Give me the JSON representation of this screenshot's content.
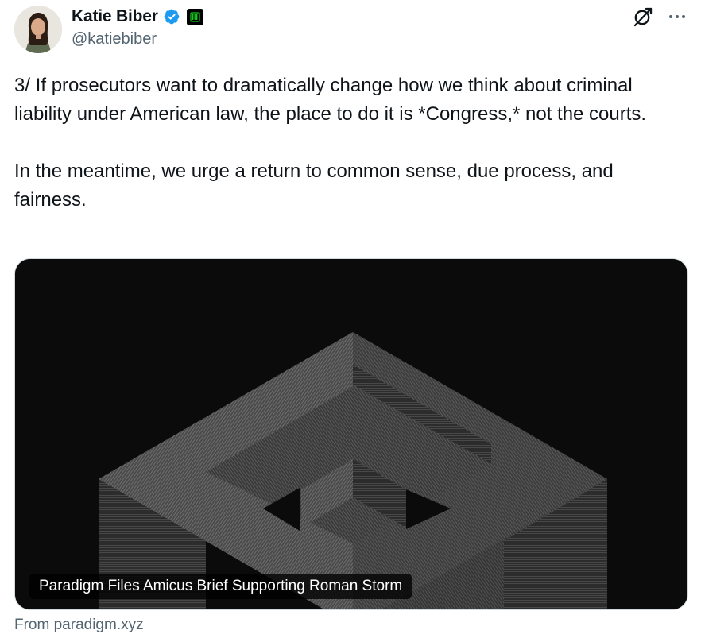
{
  "author": {
    "display_name": "Katie Biber",
    "handle": "@katiebiber",
    "verified_color": "#1d9bf0",
    "affiliate_badge_color": "#14c81e"
  },
  "tweet": {
    "paragraphs": [
      "3/ If prosecutors want to dramatically change how we think about criminal liability under American law, the place to do it is *Congress,* not the courts.",
      "In the meantime, we urge a return to common sense, due process, and fairness."
    ]
  },
  "card": {
    "title": "Paradigm Files Amicus Brief Supporting Roman Storm",
    "source": "From paradigm.xyz"
  },
  "icons": {
    "top_right": [
      "grok-icon",
      "more-icon"
    ]
  }
}
